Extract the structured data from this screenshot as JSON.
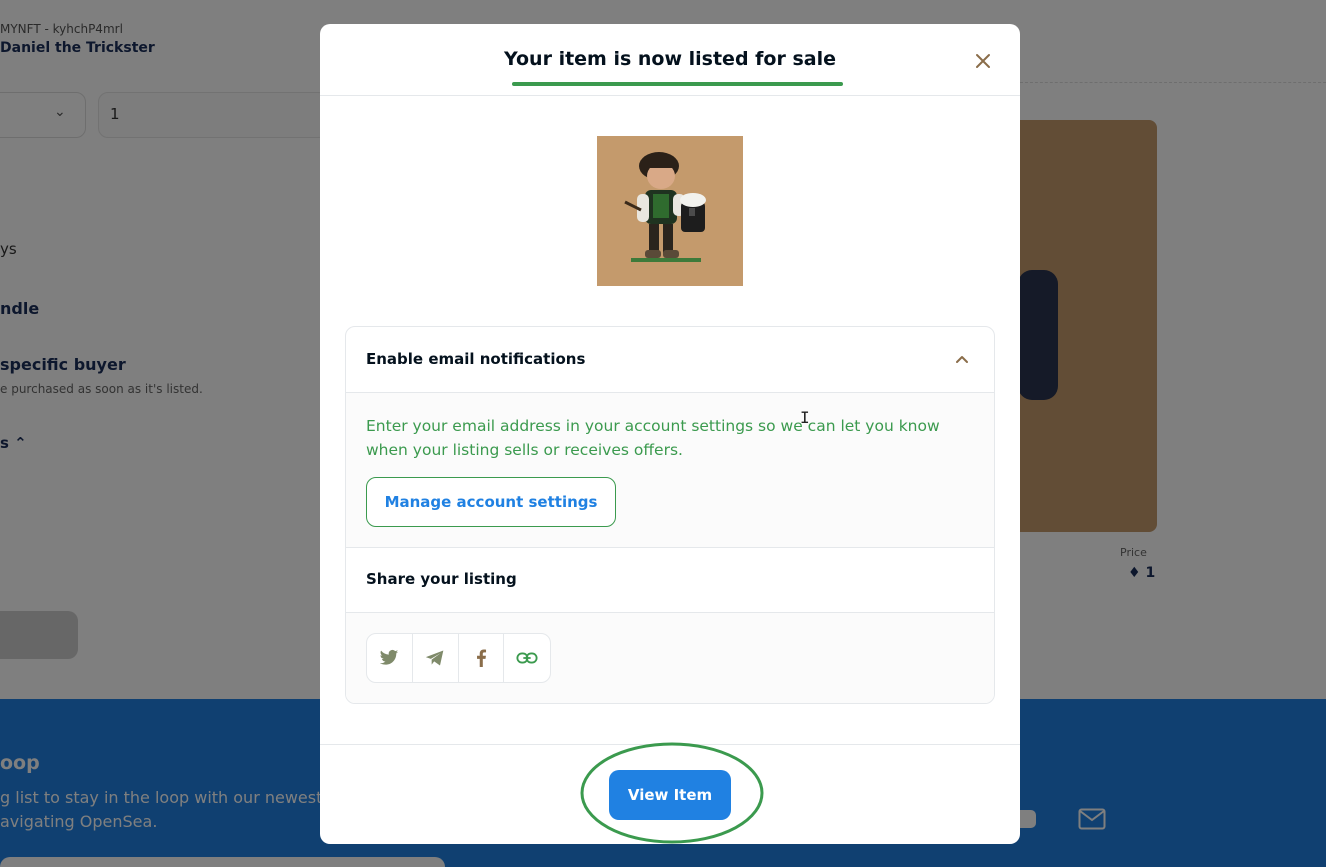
{
  "background": {
    "collection_meta": "MYNFT - kyhchP4mrl",
    "nft_name": "Daniel the Trickster",
    "quantity_value": "1",
    "fragments": [
      "ys",
      "ndle",
      "specific buyer",
      "e purchased as soon as it's listed.",
      "s"
    ],
    "price_label": "Price",
    "price_value": "1",
    "footer_heading": "oop",
    "footer_line1": "g list to stay in the loop with our newest f",
    "footer_line2": "avigating OpenSea."
  },
  "modal": {
    "title": "Your item is now listed for sale",
    "close_icon": "close-icon",
    "email_section": {
      "title": "Enable email notifications",
      "expanded": true,
      "body": "Enter your email address in your account settings so we can let you know when your listing sells or receives offers.",
      "button_label": "Manage account settings"
    },
    "share_section": {
      "title": "Share your listing",
      "buttons": [
        {
          "icon": "twitter-icon"
        },
        {
          "icon": "telegram-icon"
        },
        {
          "icon": "facebook-icon"
        },
        {
          "icon": "link-icon"
        }
      ]
    },
    "primary_button_label": "View Item"
  },
  "colors": {
    "accent_blue": "#2081e2",
    "accent_green": "#3b9a4e",
    "nft_background": "#c49a6c"
  }
}
